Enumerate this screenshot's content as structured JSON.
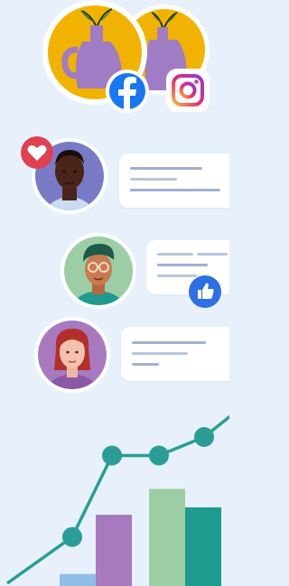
{
  "colors": {
    "background": "#e8f1fb",
    "facebook_blue": "#1877f2",
    "like_blue": "#2f6fe4",
    "heart_red": "#e0404f",
    "vase_purple": "#a07cc4",
    "sun_yellow": "#f2b300",
    "teal": "#2a9d97",
    "bar_blue": "#8fbde8",
    "bar_purple": "#a77ac0",
    "bar_green": "#9ccea5",
    "bar_teal": "#1f9a8f"
  },
  "icons": {
    "facebook": "facebook-icon",
    "instagram": "instagram-icon",
    "heart": "heart-icon",
    "thumbs_up": "thumbs-up-icon"
  },
  "chart_data": {
    "type": "bar",
    "categories": [
      "",
      "",
      "",
      ""
    ],
    "values": [
      3,
      19,
      26,
      21
    ],
    "line": {
      "y": [
        13,
        35,
        35,
        40
      ]
    },
    "title": "",
    "xlabel": "",
    "ylabel": "",
    "grid": false,
    "legend": "none"
  }
}
